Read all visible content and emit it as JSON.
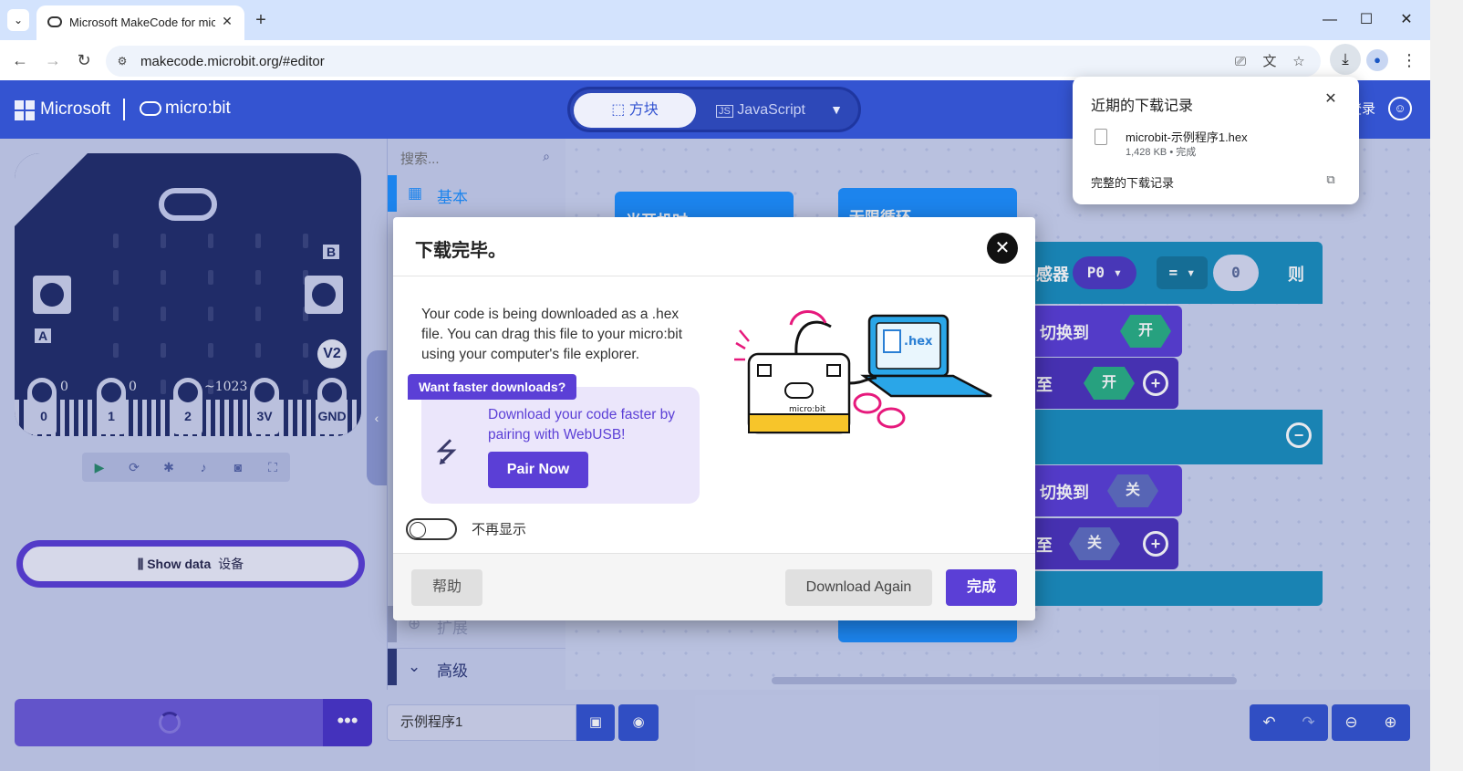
{
  "browser": {
    "tab_title": "Microsoft MakeCode for micro:bit",
    "url": "makecode.microbit.org/#editor",
    "new_tab": "+",
    "tab_close": "✕",
    "window": {
      "minimize": "—",
      "maximize": "☐",
      "close": "✕"
    }
  },
  "download_panel": {
    "title": "近期的下载记录",
    "file_name": "microbit-示例程序1.hex",
    "file_meta": "1,428 KB • 完成",
    "all_downloads": "完整的下载记录"
  },
  "header": {
    "brand": "Microsoft",
    "product": "micro:bit",
    "mode_blocks": "方块",
    "mode_js": "JavaScript",
    "login": "登录"
  },
  "simulator": {
    "button_a": "A",
    "button_b": "B",
    "version_badge": "V2",
    "pins": [
      {
        "name": "0",
        "value": "0"
      },
      {
        "name": "1",
        "value": "0"
      },
      {
        "name": "2",
        "value": "~1023"
      },
      {
        "name": "3V",
        "value": ""
      },
      {
        "name": "GND",
        "value": ""
      }
    ],
    "show_data_label": "Show data",
    "show_data_sub": "设备"
  },
  "toolbox": {
    "search_placeholder": "搜索...",
    "categories": [
      {
        "label": "基本",
        "color": "#1e90ff"
      },
      {
        "label": "扩展",
        "color": "#9aa3c9"
      },
      {
        "label": "高级",
        "color": "#2e3a7a"
      }
    ]
  },
  "workspace": {
    "on_start_label": "当开机时",
    "forever_label": "无限循环",
    "sensor_label": "感器",
    "pin_select": "P0",
    "operator": "=",
    "compare_value": "0",
    "then_label": "则",
    "switch_to_1": "切换到",
    "on_value": "开",
    "set_to_1": "至",
    "switch_to_2": "切换到",
    "off_value": "关",
    "set_to_2": "至"
  },
  "bottom_bar": {
    "project_name": "示例程序1",
    "more": "•••"
  },
  "modal": {
    "title": "下载完毕。",
    "body": "Your code is being downloaded as a .hex file. You can drag this file to your micro:bit using your computer's file explorer.",
    "promo_badge": "Want faster downloads?",
    "promo_text": "Download your code faster by pairing with WebUSB!",
    "pair_button": "Pair Now",
    "dont_show": "不再显示",
    "help_button": "帮助",
    "download_again": "Download Again",
    "done_button": "完成",
    "illustration_hex_label": ".hex",
    "illustration_board_label": "micro:bit"
  },
  "colors": {
    "header": "#3454d1",
    "accent": "#5b3fd6",
    "block_blue": "#1e90ff",
    "block_teal": "#1a8fbf"
  }
}
